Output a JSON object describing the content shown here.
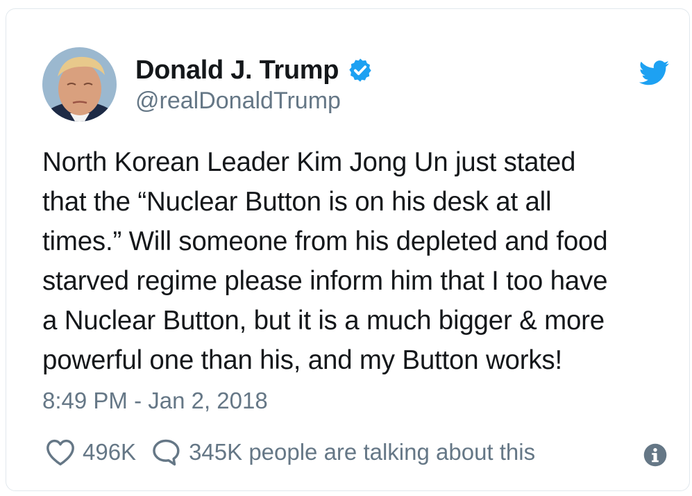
{
  "tweet": {
    "author": {
      "display_name": "Donald J. Trump",
      "handle": "@realDonaldTrump",
      "verified": true
    },
    "text_lines": [
      "North Korean Leader Kim Jong Un just stated",
      "that the “Nuclear Button is on his desk at all",
      "times.” Will someone from his depleted and food",
      "starved regime please inform him that I too have",
      "a Nuclear Button, but it is a much bigger & more",
      "powerful one than his, and my Button works!"
    ],
    "timestamp": "8:49 PM - Jan 2, 2018",
    "likes": "496K",
    "talking": "345K people are talking about this"
  },
  "icons": {
    "verified": "verified-badge-icon",
    "brand": "twitter-bird-icon",
    "like": "heart-icon",
    "reply": "speech-bubble-icon",
    "info": "info-icon"
  },
  "colors": {
    "twitter_blue": "#1da1f2",
    "text": "#14171a",
    "secondary_text": "#657786",
    "border": "#e1e8ed"
  }
}
